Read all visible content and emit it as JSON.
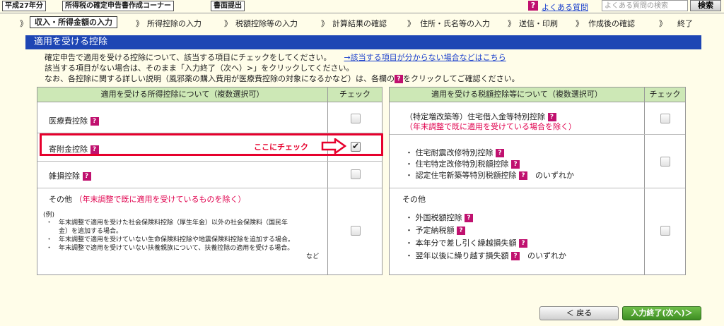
{
  "topbar": {
    "year_label": "平成27年分",
    "corner_label": "所得税の確定申告書作成コーナー",
    "submit_label": "書面提出",
    "faq_icon": "?",
    "faq_link": "よくある質問",
    "faq_search_placeholder": "よくある質問の検索",
    "search_button": "検索"
  },
  "breadcrumb": {
    "prefix": "》",
    "current": "収入・所得金額の入力",
    "steps": [
      "所得控除の入力",
      "税額控除等の入力",
      "計算結果の確認",
      "住所・氏名等の入力",
      "送信・印刷",
      "作成後の確認",
      "終了"
    ],
    "separator": "》"
  },
  "section_title": "適用を受ける控除",
  "intro": {
    "line1": "確定申告で適用を受ける控除について、該当する項目にチェックをしてください。",
    "line1_link": "→該当する項目が分からない場合などはこちら",
    "line2": "該当する項目がない場合は、そのまま「入力終了（次へ）>」をクリックしてください。",
    "line3_a": "なお、各控除に関する詳しい説明（風邪薬の購入費用が医療費控除の対象になるかなど）は、各欄の",
    "line3_b": "をクリックしてご確認ください。",
    "help_glyph": "?"
  },
  "left_table": {
    "header_item": "適用を受ける所得控除について（複数選択可）",
    "header_check": "チェック",
    "rows": [
      {
        "label": "医療費控除",
        "checked": false
      },
      {
        "label": "寄附金控除",
        "checked": true
      },
      {
        "label": "雑損控除",
        "checked": false
      }
    ],
    "other_label": "その他",
    "other_note": "（年末調整で既に適用を受けているものを除く）",
    "example_title": "(例)",
    "examples": [
      "・　年末調整で適用を受けた社会保険料控除（厚生年金）以外の社会保険料（国民年",
      "　　金）を追加する場合。",
      "・　年末調整で適用を受けていない生命保険料控除や地震保険料控除を追加する場合。",
      "・　年末調整で適用を受けていない扶養親族について、扶養控除の適用を受ける場合。"
    ],
    "examples_end": "など",
    "other_checked": false
  },
  "annotation": {
    "text": "ここにチェック"
  },
  "right_table": {
    "header_item": "適用を受ける税額控除等について（複数選択可）",
    "header_check": "チェック",
    "row1_label": "（特定増改築等）住宅借入金等特別控除",
    "row1_note": "（年末調整で既に適用を受けている場合を除く）",
    "row1_checked": false,
    "row2_items": [
      "住宅耐震改修特別控除",
      "住宅特定改修特別税額控除",
      "認定住宅新築等特別税額控除"
    ],
    "row2_suffix": "のいずれか",
    "row2_checked": false,
    "other_label": "その他",
    "other_items": [
      "外国税額控除",
      "予定納税額",
      "本年分で差し引く繰越損失額",
      "翌年以後に繰り越す損失額"
    ],
    "other_suffix": "のいずれか",
    "other_checked": false
  },
  "footer": {
    "back_button": "＜ 戻る",
    "next_button": "入力終了(次へ)＞"
  }
}
